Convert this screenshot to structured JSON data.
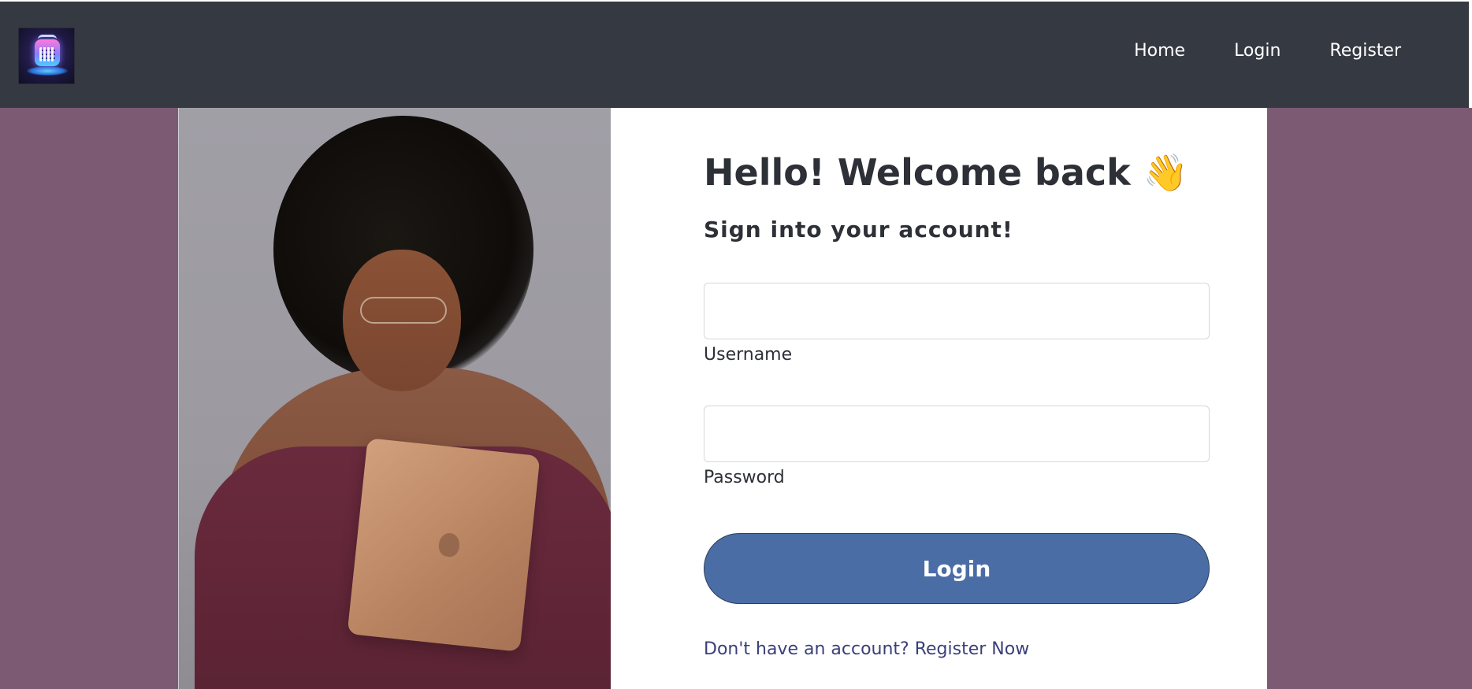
{
  "nav": {
    "links": [
      {
        "label": "Home"
      },
      {
        "label": "Login"
      },
      {
        "label": "Register"
      }
    ]
  },
  "logo": {
    "icon": "calendar-app-logo-icon"
  },
  "hero_image": {
    "icon": "woman-with-tablet-photo"
  },
  "login": {
    "title": "Hello! Welcome back 👋",
    "subtitle": "Sign into your account!",
    "username_label": "Username",
    "password_label": "Password",
    "username_value": "",
    "password_value": "",
    "submit_label": "Login",
    "register_prompt": "Don't have an account? Register Now"
  },
  "colors": {
    "navbar": "#353a42",
    "page_background": "#7d5a74",
    "card_background": "#ffffff",
    "primary_button": "#4a6da6",
    "link": "#3a3f7a"
  }
}
